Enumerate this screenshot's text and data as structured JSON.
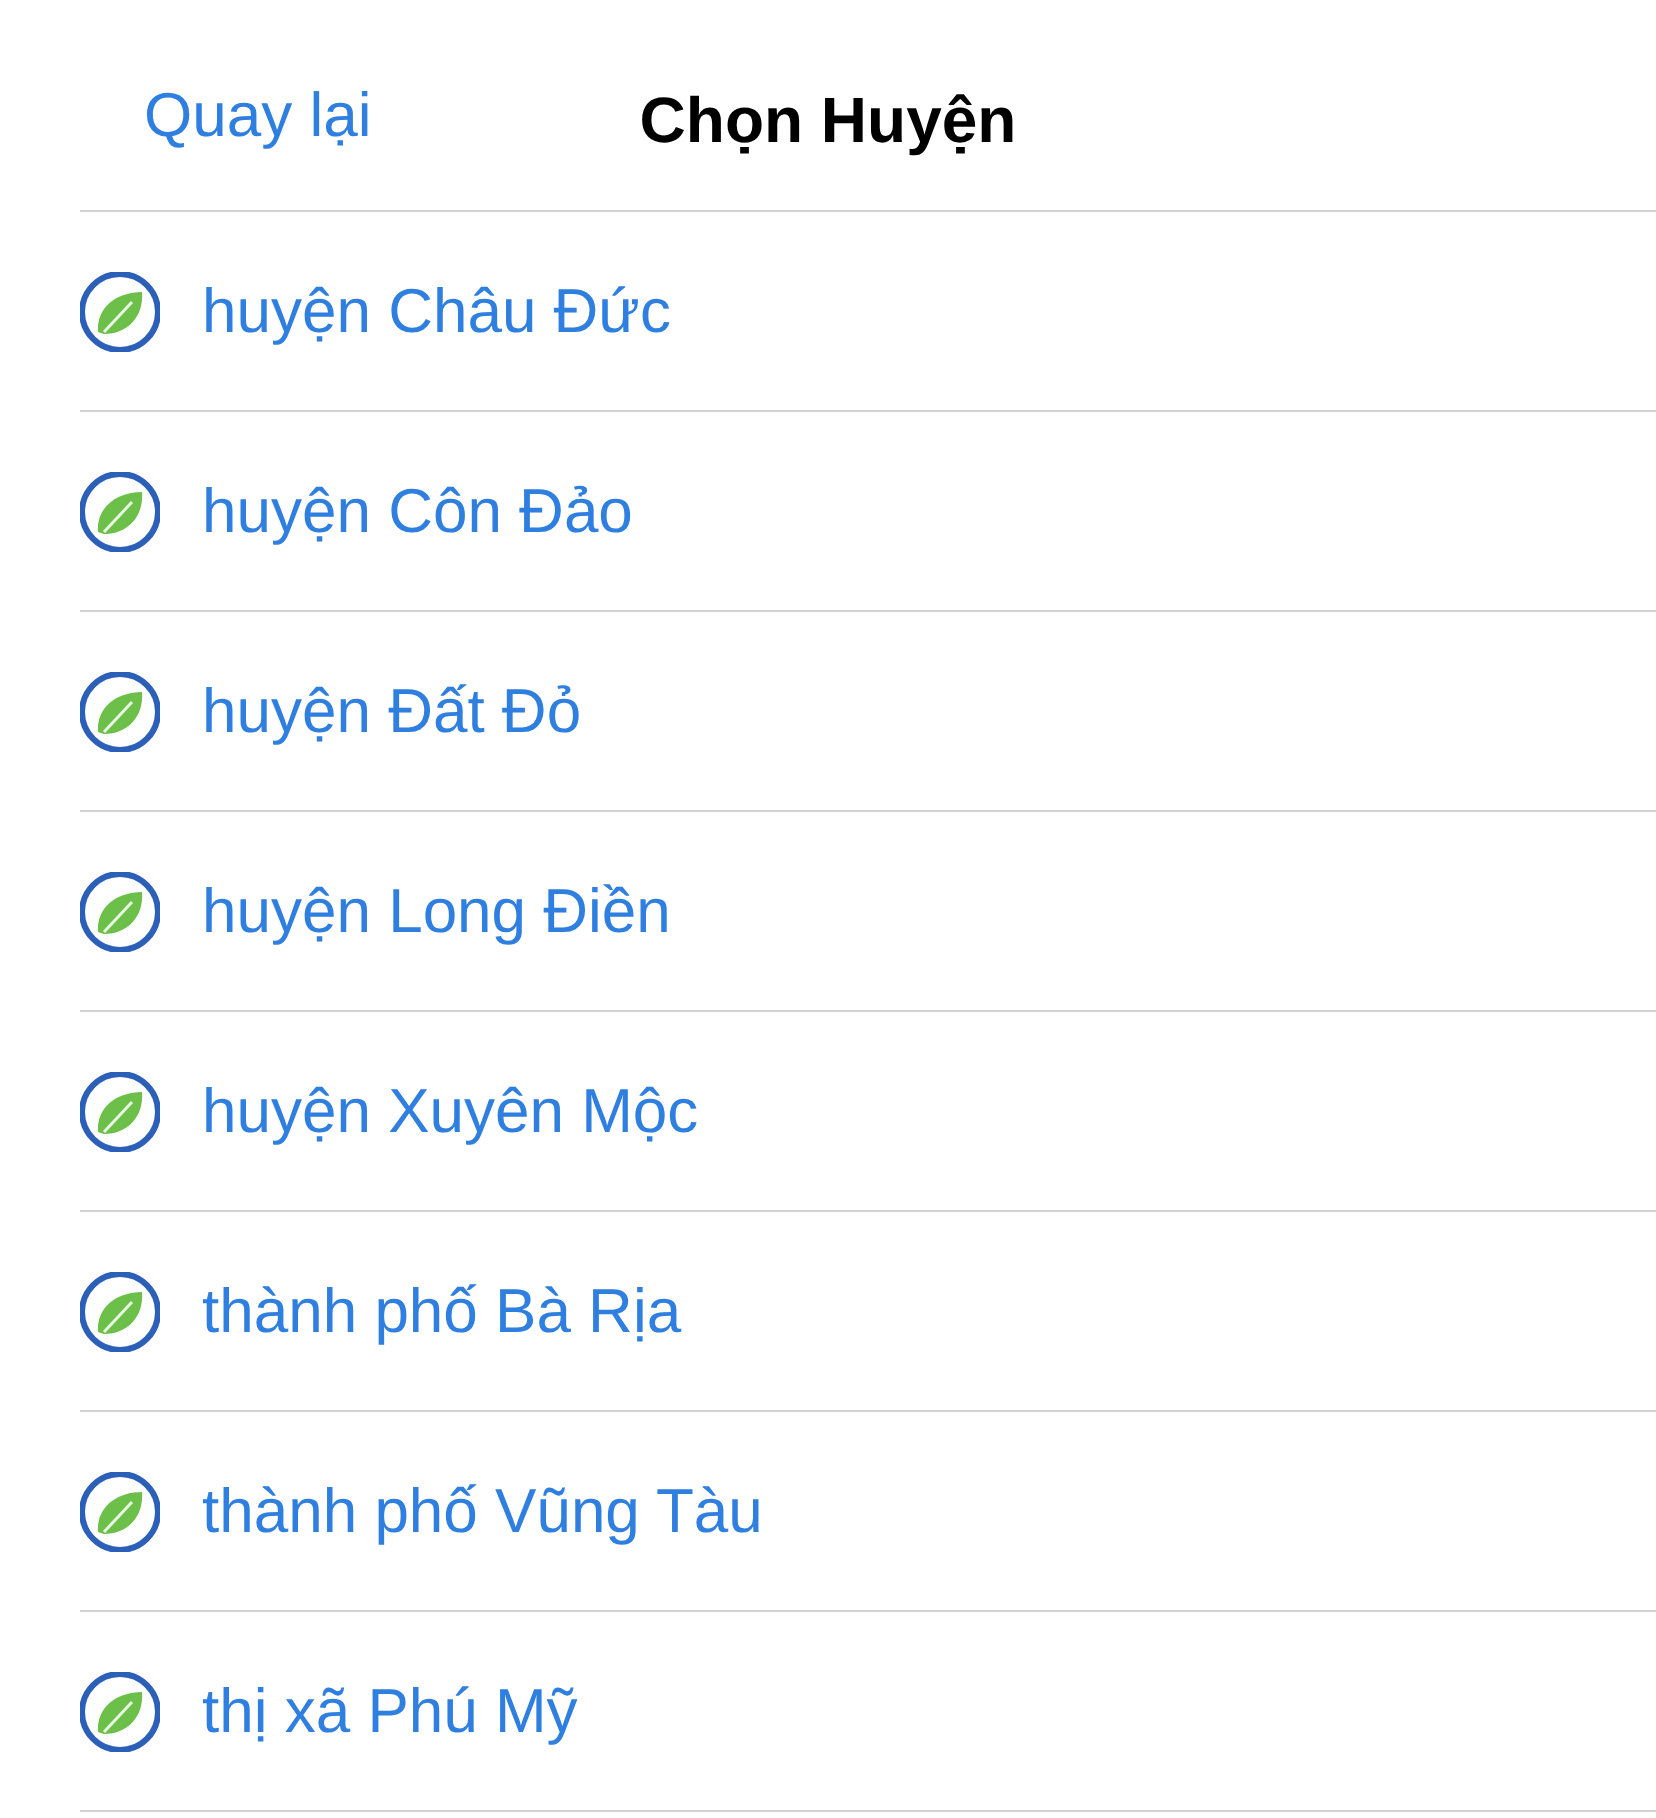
{
  "nav_bar": {
    "back": "Quay lại",
    "title": "Chọn Huyện"
  },
  "items": [
    {
      "label": "huyện Châu Đức"
    },
    {
      "label": "huyện Côn Đảo"
    },
    {
      "label": "huyện Đất Đỏ"
    },
    {
      "label": "huyện Long Điền"
    },
    {
      "label": "huyện Xuyên Mộc"
    },
    {
      "label": "thành phố Bà Rịa"
    },
    {
      "label": "thành phố Vũng Tàu"
    },
    {
      "label": "thị xã Phú Mỹ"
    }
  ]
}
